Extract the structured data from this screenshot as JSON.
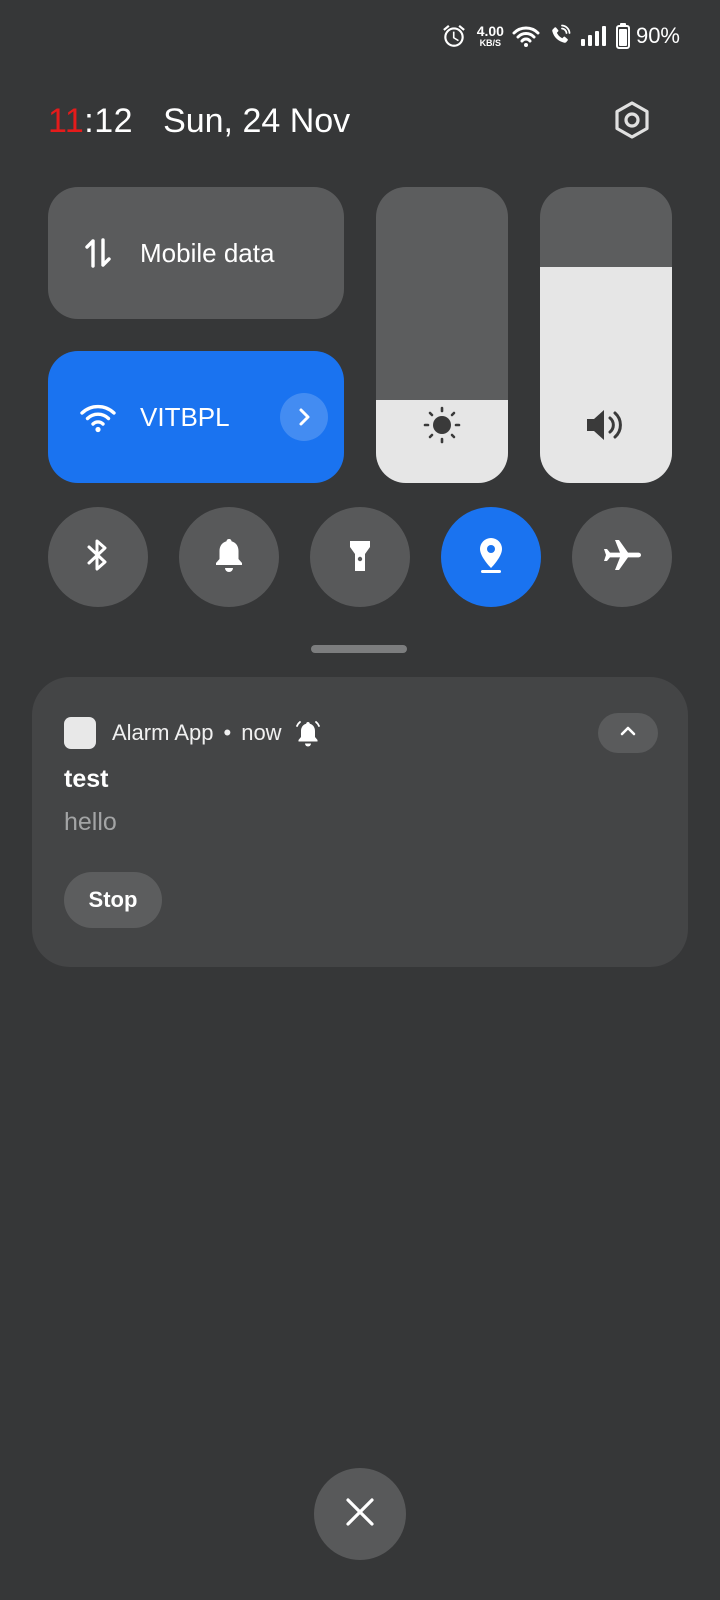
{
  "status_bar": {
    "net_speed_value": "4.00",
    "net_speed_unit": "KB/S",
    "battery_percent": "90%",
    "icons": [
      "alarm-icon",
      "wifi-icon",
      "wifi-calling-icon",
      "cellular-signal-icon",
      "battery-icon"
    ]
  },
  "header": {
    "clock_hours": "11",
    "clock_rest": ":12",
    "date": "Sun, 24 Nov",
    "settings_icon": "settings-icon"
  },
  "tiles": {
    "mobile_data": {
      "label": "Mobile data",
      "icon": "mobile-data-icon"
    },
    "wifi": {
      "label": "VITBPL",
      "icon": "wifi-icon",
      "active": true
    }
  },
  "sliders": {
    "brightness": {
      "icon": "brightness-icon",
      "level": 0.28
    },
    "volume": {
      "icon": "volume-icon",
      "level": 0.73
    }
  },
  "toggles": [
    {
      "icon": "bluetooth-icon",
      "active": false
    },
    {
      "icon": "bell-icon",
      "active": false
    },
    {
      "icon": "flashlight-icon",
      "active": false
    },
    {
      "icon": "location-icon",
      "active": true
    },
    {
      "icon": "airplane-icon",
      "active": false
    }
  ],
  "notification": {
    "app_name": "Alarm App",
    "separator": "•",
    "time": "now",
    "title": "test",
    "body": "hello",
    "action_label": "Stop"
  },
  "colors": {
    "accent": "#1a73f0",
    "background": "#363738",
    "clock_hours": "#e51b1b"
  }
}
